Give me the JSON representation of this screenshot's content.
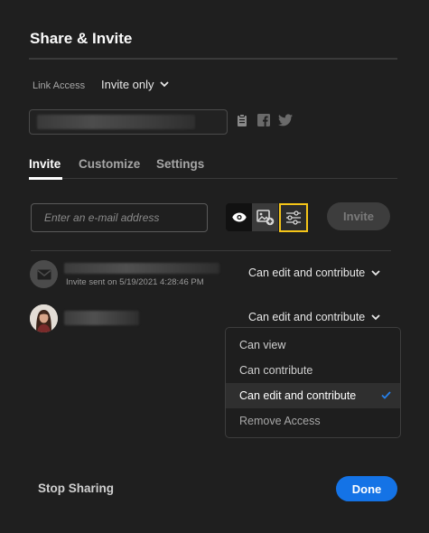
{
  "dialog": {
    "title": "Share & Invite"
  },
  "link_access": {
    "label": "Link Access",
    "value": "Invite only",
    "icons": [
      "clipboard-icon",
      "facebook-icon",
      "twitter-icon"
    ]
  },
  "tabs": [
    {
      "label": "Invite",
      "active": true
    },
    {
      "label": "Customize",
      "active": false
    },
    {
      "label": "Settings",
      "active": false
    }
  ],
  "invite": {
    "email_placeholder": "Enter an e-mail address",
    "permission_icons": [
      "eye-icon",
      "image-add-icon",
      "sliders-icon"
    ],
    "invite_label": "Invite"
  },
  "collaborators": [
    {
      "avatar": "mail-icon",
      "sent_note": "Invite sent on 5/19/2021 4:28:46 PM",
      "permission": "Can edit and contribute"
    },
    {
      "avatar": "profile-photo",
      "permission": "Can edit and contribute"
    }
  ],
  "permission_menu": {
    "items": [
      {
        "label": "Can view",
        "selected": false
      },
      {
        "label": "Can contribute",
        "selected": false
      },
      {
        "label": "Can edit and contribute",
        "selected": true
      },
      {
        "label": "Remove Access",
        "selected": false
      }
    ]
  },
  "footer": {
    "stop_sharing": "Stop Sharing",
    "done": "Done"
  },
  "colors": {
    "background": "#1f1f1f",
    "accent": "#1473e6",
    "highlight": "#f5c518"
  }
}
